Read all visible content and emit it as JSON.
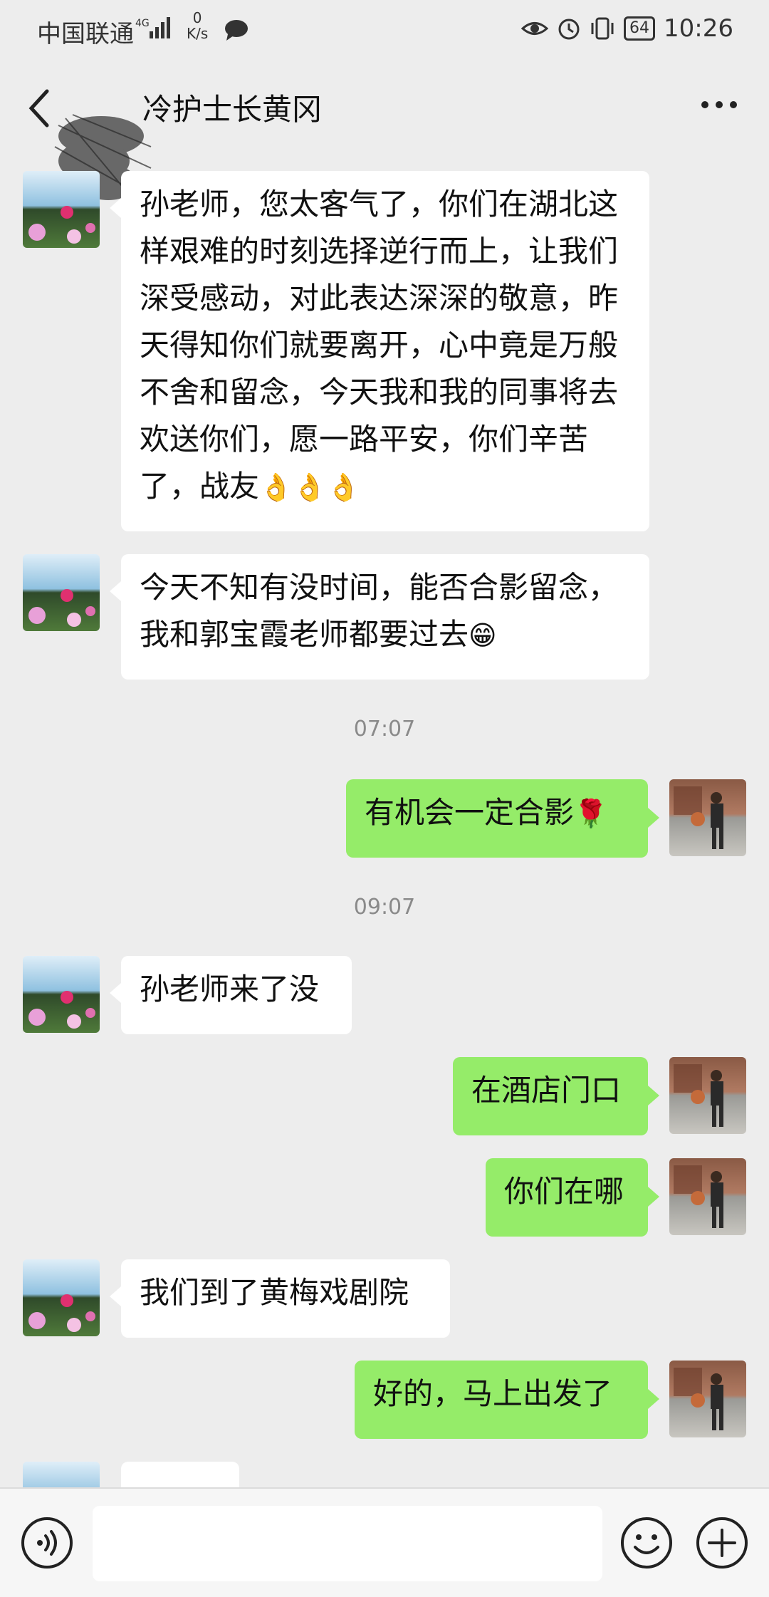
{
  "status_bar": {
    "carrier": "中国联通",
    "network": "4G",
    "speed_value": "0",
    "speed_unit": "K/s",
    "battery": "64",
    "time": "10:26"
  },
  "header": {
    "title": "冷护士长黄冈"
  },
  "messages": [
    {
      "side": "left",
      "text": "孙老师，您太客气了，你们在湖北这样艰难的时刻选择逆行而上，让我们深受感动，对此表达深深的敬意，昨天得知你们就要离开，心中竟是万般不舍和留念，今天我和我的同事将去欢送你们，愿一路平安，你们辛苦了，战友",
      "emoji": "👌👌👌"
    },
    {
      "side": "left",
      "text": "今天不知有没时间，能否合影留念，我和郭宝霞老师都要过去",
      "emoji": "😁"
    },
    {
      "side": "time",
      "text": "07:07"
    },
    {
      "side": "right",
      "text": "有机会一定合影",
      "emoji": "🌹"
    },
    {
      "side": "time",
      "text": "09:07"
    },
    {
      "side": "left",
      "text": "孙老师来了没"
    },
    {
      "side": "right",
      "text": "在酒店门口"
    },
    {
      "side": "right",
      "text": "你们在哪"
    },
    {
      "side": "left",
      "text": "我们到了黄梅戏剧院"
    },
    {
      "side": "right",
      "text": "好的，马上出发了"
    }
  ],
  "colors": {
    "background": "#ededed",
    "sent_bubble": "#95ec69",
    "received_bubble": "#ffffff"
  },
  "icons": {
    "back": "chevron-left-icon",
    "more": "more-dots-icon",
    "voice": "voice-icon",
    "emoji": "emoji-face-icon",
    "plus": "plus-icon"
  }
}
